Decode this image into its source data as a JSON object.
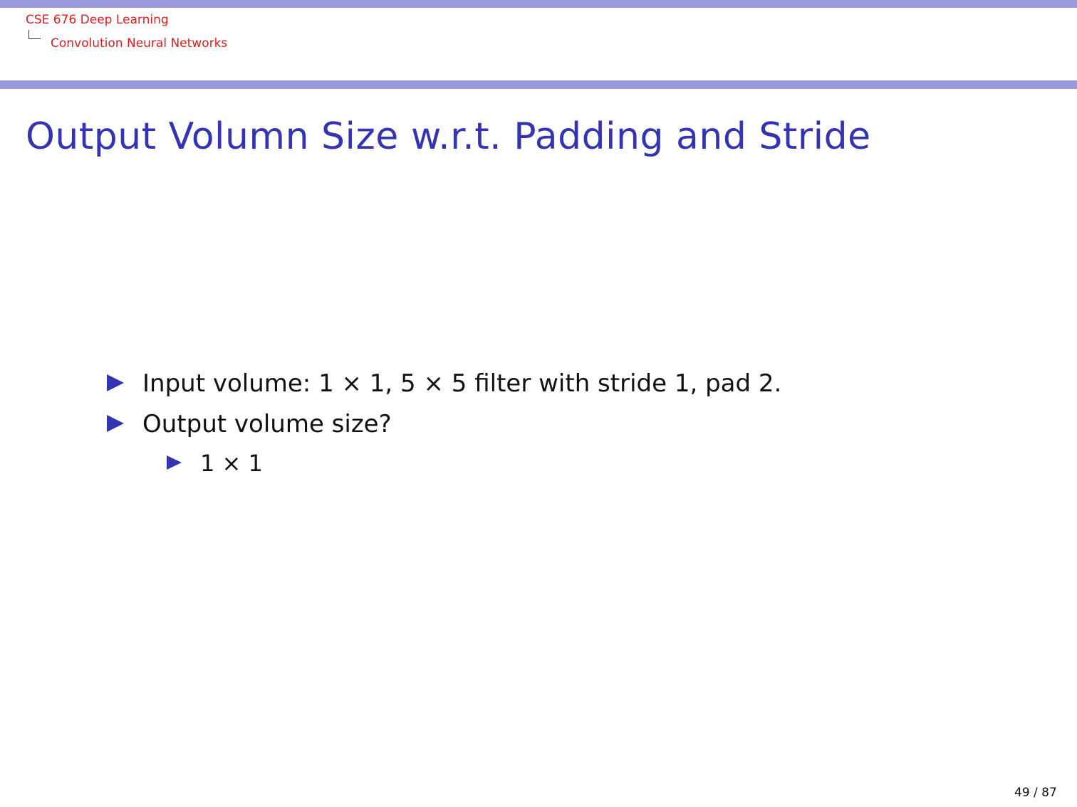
{
  "header": {
    "course": "CSE 676 Deep Learning",
    "section": "Convolution Neural Networks"
  },
  "slide": {
    "title": "Output Volumn Size w.r.t. Padding and Stride",
    "bullets": [
      "Input volume: 1 × 1, 5 × 5 filter with stride 1, pad 2.",
      "Output volume size?"
    ],
    "sub_bullets": [
      "1 × 1"
    ]
  },
  "footer": {
    "page_number": "49 / 87"
  },
  "colors": {
    "header_bar": "#9a9adc",
    "title": "#3333b3",
    "breadcrumb": "#e41b1b",
    "bullet_icon": "#3333b3"
  },
  "icons": {
    "bullet": "triangle-right-icon",
    "breadcrumb_branch": "tree-branch-icon"
  }
}
